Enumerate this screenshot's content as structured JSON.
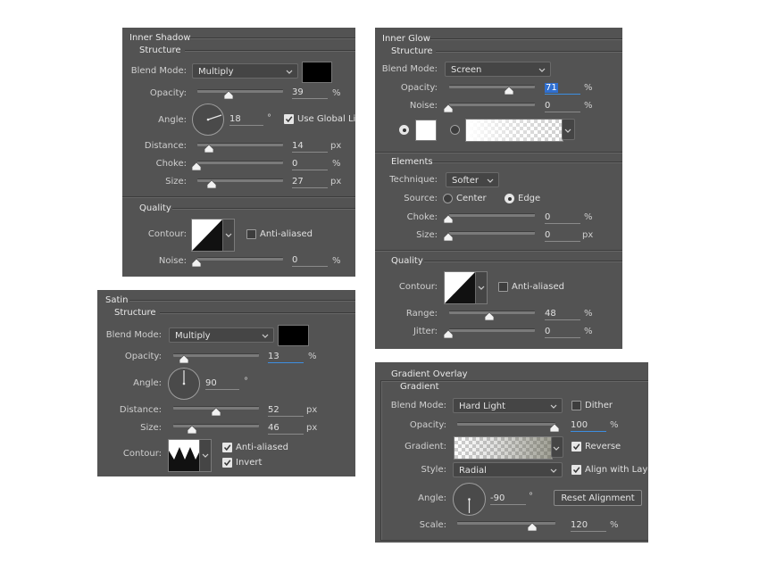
{
  "inner_shadow": {
    "title": "Inner Shadow",
    "structure": "Structure",
    "blend_mode_label": "Blend Mode:",
    "blend_mode": "Multiply",
    "opacity_label": "Opacity:",
    "opacity": "39",
    "angle_label": "Angle:",
    "angle": "18",
    "use_global_light": "Use Global Light",
    "distance_label": "Distance:",
    "distance": "14",
    "choke_label": "Choke:",
    "choke": "0",
    "size_label": "Size:",
    "size": "27",
    "quality": "Quality",
    "contour_label": "Contour:",
    "anti_aliased": "Anti-aliased",
    "noise_label": "Noise:",
    "noise": "0",
    "pct": "%",
    "px": "px",
    "deg": "°",
    "color": "#000000"
  },
  "satin": {
    "title": "Satin",
    "structure": "Structure",
    "blend_mode_label": "Blend Mode:",
    "blend_mode": "Multiply",
    "opacity_label": "Opacity:",
    "opacity": "13",
    "angle_label": "Angle:",
    "angle": "90",
    "distance_label": "Distance:",
    "distance": "52",
    "size_label": "Size:",
    "size": "46",
    "contour_label": "Contour:",
    "anti_aliased": "Anti-aliased",
    "invert": "Invert",
    "pct": "%",
    "px": "px",
    "deg": "°",
    "color": "#000000"
  },
  "inner_glow": {
    "title": "Inner Glow",
    "structure": "Structure",
    "blend_mode_label": "Blend Mode:",
    "blend_mode": "Screen",
    "opacity_label": "Opacity:",
    "opacity": "71",
    "noise_label": "Noise:",
    "noise": "0",
    "elements": "Elements",
    "technique_label": "Technique:",
    "technique": "Softer",
    "source_label": "Source:",
    "source_center": "Center",
    "source_edge": "Edge",
    "choke_label": "Choke:",
    "choke": "0",
    "size_label": "Size:",
    "size": "0",
    "quality": "Quality",
    "contour_label": "Contour:",
    "anti_aliased": "Anti-aliased",
    "range_label": "Range:",
    "range": "48",
    "jitter_label": "Jitter:",
    "jitter": "0",
    "pct": "%",
    "px": "px",
    "color": "#ffffff"
  },
  "gradient_overlay": {
    "title": "Gradient Overlay",
    "gradient_group": "Gradient",
    "blend_mode_label": "Blend Mode:",
    "blend_mode": "Hard Light",
    "dither": "Dither",
    "opacity_label": "Opacity:",
    "opacity": "100",
    "gradient_label": "Gradient:",
    "reverse": "Reverse",
    "style_label": "Style:",
    "style": "Radial",
    "align_with_layer": "Align with Layer",
    "angle_label": "Angle:",
    "angle": "-90",
    "reset_alignment": "Reset Alignment",
    "scale_label": "Scale:",
    "scale": "120",
    "pct": "%",
    "deg": "°"
  }
}
